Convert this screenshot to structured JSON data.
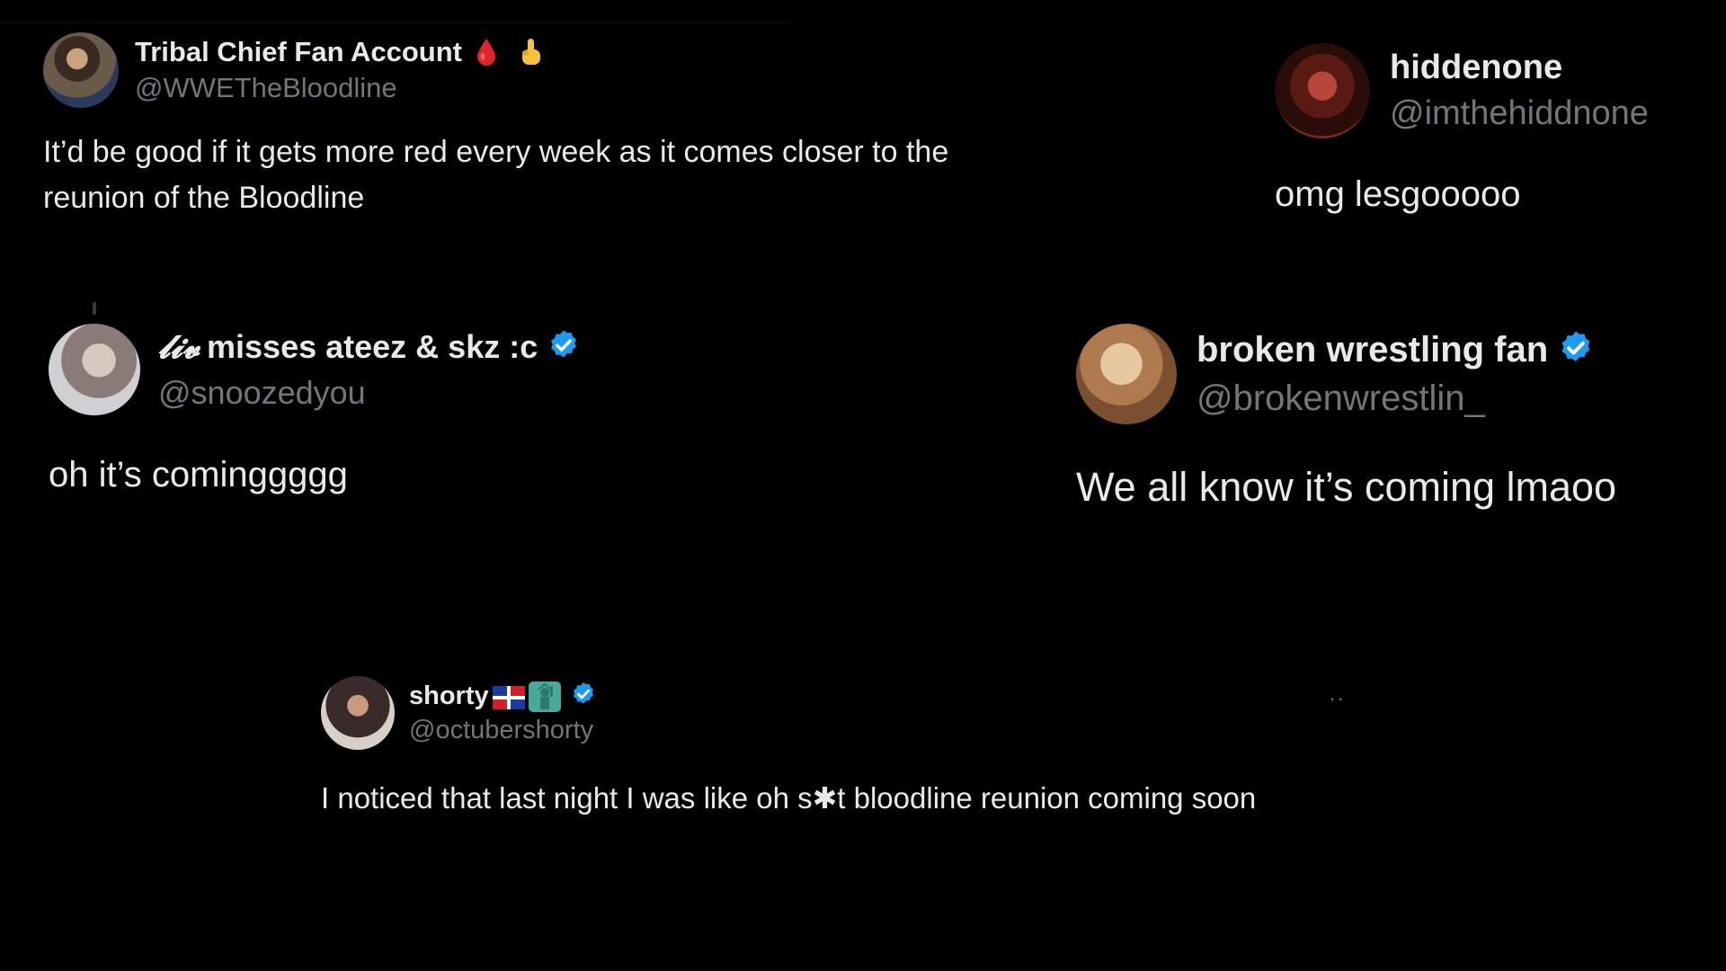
{
  "tweets": [
    {
      "display_name": "Tribal Chief Fan Account",
      "handle": "@WWETheBloodline",
      "emojis": [
        "blood-drop-icon",
        "pointing-up-hand-icon"
      ],
      "verified": false,
      "body": "It’d be good if it gets more red every week as it comes closer to the reunion of the Bloodline"
    },
    {
      "display_name": "hiddenone",
      "handle": "@imthehiddnone",
      "verified": false,
      "body": "omg lesgooooo"
    },
    {
      "display_name_script": "𝓵𝓲𝓿",
      "display_name": "misses ateez & skz :c",
      "handle": "@snoozedyou",
      "verified": true,
      "body": "oh it’s cominggggg"
    },
    {
      "display_name": "broken wrestling fan",
      "handle": "@brokenwrestlin_",
      "verified": true,
      "body": "We all know it’s coming lmaoo"
    },
    {
      "display_name": "shorty",
      "handle": "@octubershorty",
      "emojis": [
        "dominican-flag-icon",
        "statue-of-liberty-icon"
      ],
      "verified": true,
      "more_label": "··",
      "body": "I noticed that last night I was like oh s✱t bloodline reunion coming soon"
    }
  ],
  "colors": {
    "background": "#000000",
    "text_primary": "#e7e9ea",
    "text_secondary": "#71767b",
    "verified_blue": "#1d9bf0"
  }
}
